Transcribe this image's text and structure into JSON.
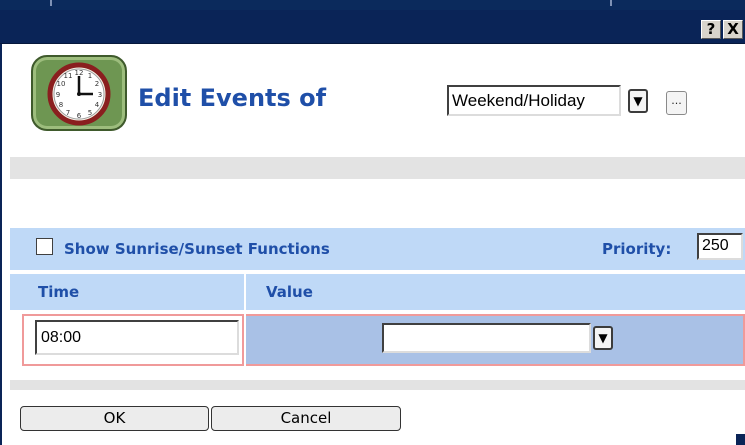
{
  "titlebar": {
    "help_label": "?",
    "close_label": "X"
  },
  "header": {
    "title": "Edit Events of",
    "schedule_select": {
      "value": "Weekend/Holiday",
      "dropdown_glyph": "▼",
      "more_label": "..."
    }
  },
  "options": {
    "sunrise_checkbox_checked": false,
    "sunrise_label": "Show Sunrise/Sunset Functions",
    "priority_label": "Priority:",
    "priority_value": "250"
  },
  "table": {
    "columns": [
      "Time",
      "Value"
    ],
    "rows": [
      {
        "time": "08:00",
        "value": "",
        "dropdown_glyph": "▼"
      }
    ]
  },
  "footer": {
    "ok_label": "OK",
    "cancel_label": "Cancel"
  },
  "colors": {
    "titlebar": "#0a2457",
    "heading_text": "#1f4fa8",
    "band_light_blue": "#bfd9f7",
    "value_cell": "#a9c1e6",
    "row_border": "#f09a9a",
    "clock_frame": "#6e9652"
  },
  "icons": [
    "clock-icon",
    "help-icon",
    "close-icon",
    "dropdown-arrow-icon"
  ]
}
